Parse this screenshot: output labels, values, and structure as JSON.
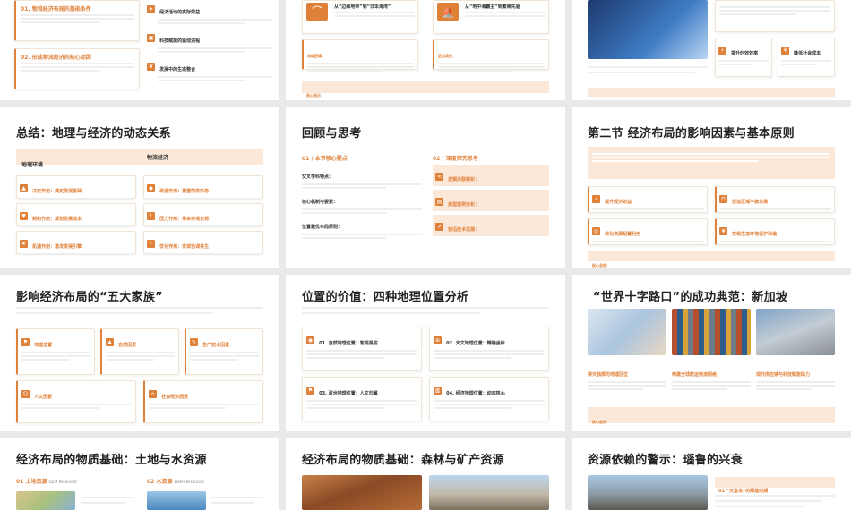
{
  "row1": {
    "s1": {
      "item1": "01. 物流经济布局的基础条件",
      "item2": "02. 形成物流经济的核心动因",
      "right1": "经济活动的实际效益",
      "right2": "科技赋能的驱动进程",
      "right3": "发展中的生态整合"
    },
    "s2": {
      "card1": "从“边缘地带”到“日本海湾”",
      "card2": "从“地中海霸主”到繁荣先驱",
      "tag_left": "地缘逻辑：",
      "tag_right": "区位演变：",
      "core": "核心启示："
    },
    "s3": {
      "c1": "提升时效效率",
      "c2": "降低社会成本"
    }
  },
  "row2": {
    "s1": {
      "title": "总结：地理与经济的动态关系",
      "band_left": "地理环境",
      "band_right": "物流经济",
      "items_left": [
        "决定作用：奠定发展基础",
        "制约作用：规划发展成本",
        "机遇作用：激发发展引擎"
      ],
      "items_right": [
        "改造作用：重塑地表形态",
        "压力作用：带来环境负荷",
        "优化作用：实现协调共生"
      ]
    },
    "s2": {
      "title": "回顾与思考",
      "sub_left": "01 / 本节核心要点",
      "sub_right": "02 / 深度探究思考",
      "points_left": [
        "交叉学科特点：",
        "核心机制与要素：",
        "位置最优布局原则："
      ],
      "points_right": [
        "逻辑关联解析：",
        "典型案例分析：",
        "前沿技术发展："
      ]
    },
    "s3": {
      "title": "第二节 经济布局的影响因素与基本原则",
      "items": [
        "提升经济效益",
        "促进区域平衡发展",
        "优化资源配置利用",
        "实现生态环境保护和谐"
      ],
      "core": "核心总结："
    }
  },
  "row3": {
    "s1": {
      "title": "影响经济布局的“五大家族”",
      "items": [
        "地理位置",
        "自然因素",
        "生产技术因素",
        "人文因素",
        "社会经济因素"
      ]
    },
    "s2": {
      "title": "位置的价值：四种地理位置分析",
      "items": [
        "01. 自然地理位置：客观基底",
        "02. 天文地理位置：精确坐标",
        "03. 政治地理位置：人文归属",
        "04. 经济地理位置：动态核心"
      ]
    },
    "s3": {
      "title": "“世界十字路口”的成功典范：新加坡",
      "items": [
        "得天独厚的地理区位",
        "构建全球航运物流网络",
        "现代供应链与科技赋能助力"
      ],
      "core": "核心启示："
    }
  },
  "row4": {
    "s1": {
      "title": "经济布局的物质基础：土地与水资源",
      "tab1": "01 土地资源",
      "tab1_en": "Land Resources",
      "tab2": "02 水资源",
      "tab2_en": "Water Resources"
    },
    "s2": {
      "title": "经济布局的物质基础：森林与矿产资源"
    },
    "s3": {
      "title": "资源依赖的警示：瑙鲁的兴衰",
      "badge": "01 “天堂岛”的辉煌时期"
    }
  },
  "colors": {
    "accent": "#e0813a",
    "band": "#fbe8d8"
  }
}
